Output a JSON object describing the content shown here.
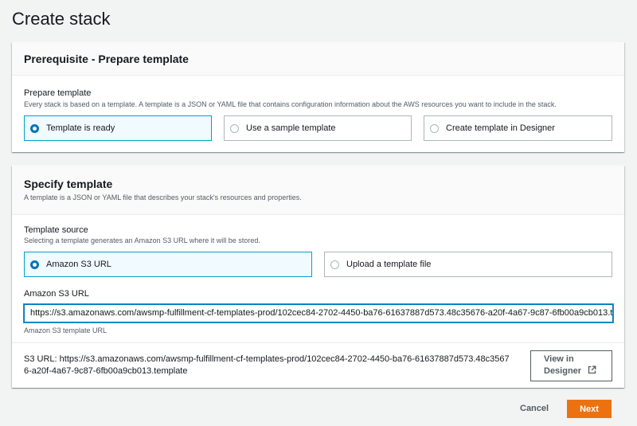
{
  "page": {
    "title": "Create stack"
  },
  "prerequisite": {
    "title": "Prerequisite - Prepare template",
    "field_label": "Prepare template",
    "field_description": "Every stack is based on a template. A template is a JSON or YAML file that contains configuration information about the AWS resources you want to include in the stack.",
    "options": [
      {
        "label": "Template is ready",
        "selected": true
      },
      {
        "label": "Use a sample template",
        "selected": false
      },
      {
        "label": "Create template in Designer",
        "selected": false
      }
    ]
  },
  "specify": {
    "title": "Specify template",
    "subtitle": "A template is a JSON or YAML file that describes your stack's resources and properties.",
    "source_label": "Template source",
    "source_description": "Selecting a template generates an Amazon S3 URL where it will be stored.",
    "options": [
      {
        "label": "Amazon S3 URL",
        "selected": true
      },
      {
        "label": "Upload a template file",
        "selected": false
      }
    ],
    "url_label": "Amazon S3 URL",
    "url_value": "https://s3.amazonaws.com/awsmp-fulfillment-cf-templates-prod/102cec84-2702-4450-ba76-61637887d573.48c35676-a20f-4a67-9c87-6fb00a9cb013.template",
    "url_hint": "Amazon S3 template URL",
    "s3_url_label": "S3 URL:",
    "s3_url_line1": "https://s3.amazonaws.com/awsmp-fulfillment-cf-templates-prod/102cec84-2702-4450-ba76-61637887d573.48c3567",
    "s3_url_line2": "6-a20f-4a67-9c87-6fb00a9cb013.template",
    "view_designer_line1": "View in",
    "view_designer_line2": "Designer"
  },
  "footer": {
    "cancel_label": "Cancel",
    "next_label": "Next"
  },
  "colors": {
    "accent": "#0073bb",
    "selected_border": "#00a1c9",
    "primary_button": "#ec7211"
  }
}
